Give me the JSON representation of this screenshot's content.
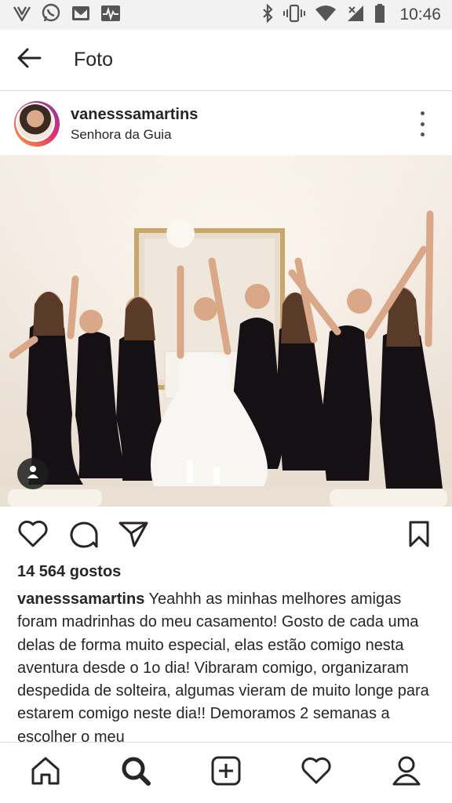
{
  "status_bar": {
    "time": "10:46",
    "left_icons": [
      "vivo-icon",
      "whatsapp-icon",
      "gmail-icon",
      "activity-icon"
    ],
    "right_icons": [
      "bluetooth-icon",
      "vibrate-icon",
      "wifi-icon",
      "no-signal-icon",
      "battery-icon"
    ]
  },
  "app_bar": {
    "title": "Foto"
  },
  "post": {
    "username": "vanesssamartins",
    "location": "Senhora da Guia",
    "likes": "14 564 gostos",
    "caption_user": "vanesssamartins",
    "caption_text": " Yeahhh as minhas melhores amigas foram madrinhas do meu casamento! Gosto de cada uma delas de forma muito especial, elas estão comigo nesta aventura desde o 1o dia! Vibraram comigo, organizaram despedida de solteira, algumas vieram de muito longe para estarem comigo neste dia!! Demoramos 2 semanas a escolher o meu"
  },
  "bottom_nav": [
    "home-icon",
    "search-icon",
    "new-post-icon",
    "activity-heart-icon",
    "profile-icon"
  ],
  "colors": {
    "icon": "#262626",
    "status_bar_bg": "#f2f2f2",
    "divider": "#dbdbdb"
  }
}
